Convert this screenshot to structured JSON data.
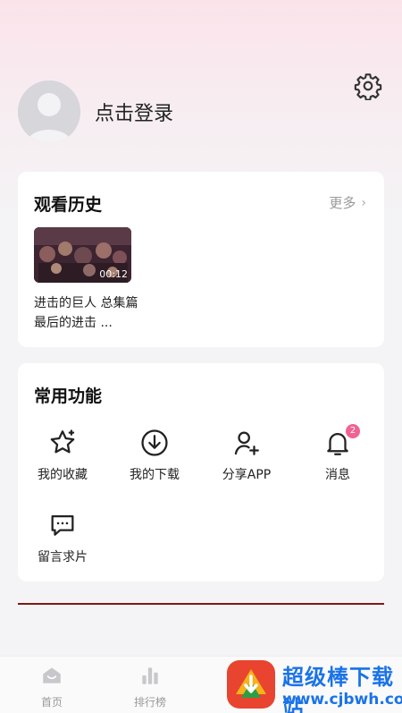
{
  "header": {
    "login_text": "点击登录"
  },
  "history": {
    "title": "观看历史",
    "more": "更多",
    "video": {
      "time": "00:12",
      "title": "进击的巨人 总集篇 最后的进击 ..."
    }
  },
  "functions": {
    "title": "常用功能",
    "items": [
      {
        "label": "我的收藏",
        "icon": "star-icon"
      },
      {
        "label": "我的下载",
        "icon": "download-icon"
      },
      {
        "label": "分享APP",
        "icon": "add-user-icon"
      },
      {
        "label": "消息",
        "icon": "bell-icon",
        "badge": "2"
      },
      {
        "label": "留言求片",
        "icon": "chat-icon"
      }
    ]
  },
  "tabbar": {
    "items": [
      {
        "label": "首页",
        "icon": "home-icon"
      },
      {
        "label": "排行榜",
        "icon": "ranking-icon"
      }
    ]
  },
  "watermark": {
    "title": "超级棒下载站",
    "url": "www.cjbwh.com"
  },
  "colors": {
    "accent_badge": "#f06292",
    "watermark_blue": "#1a73e8"
  }
}
